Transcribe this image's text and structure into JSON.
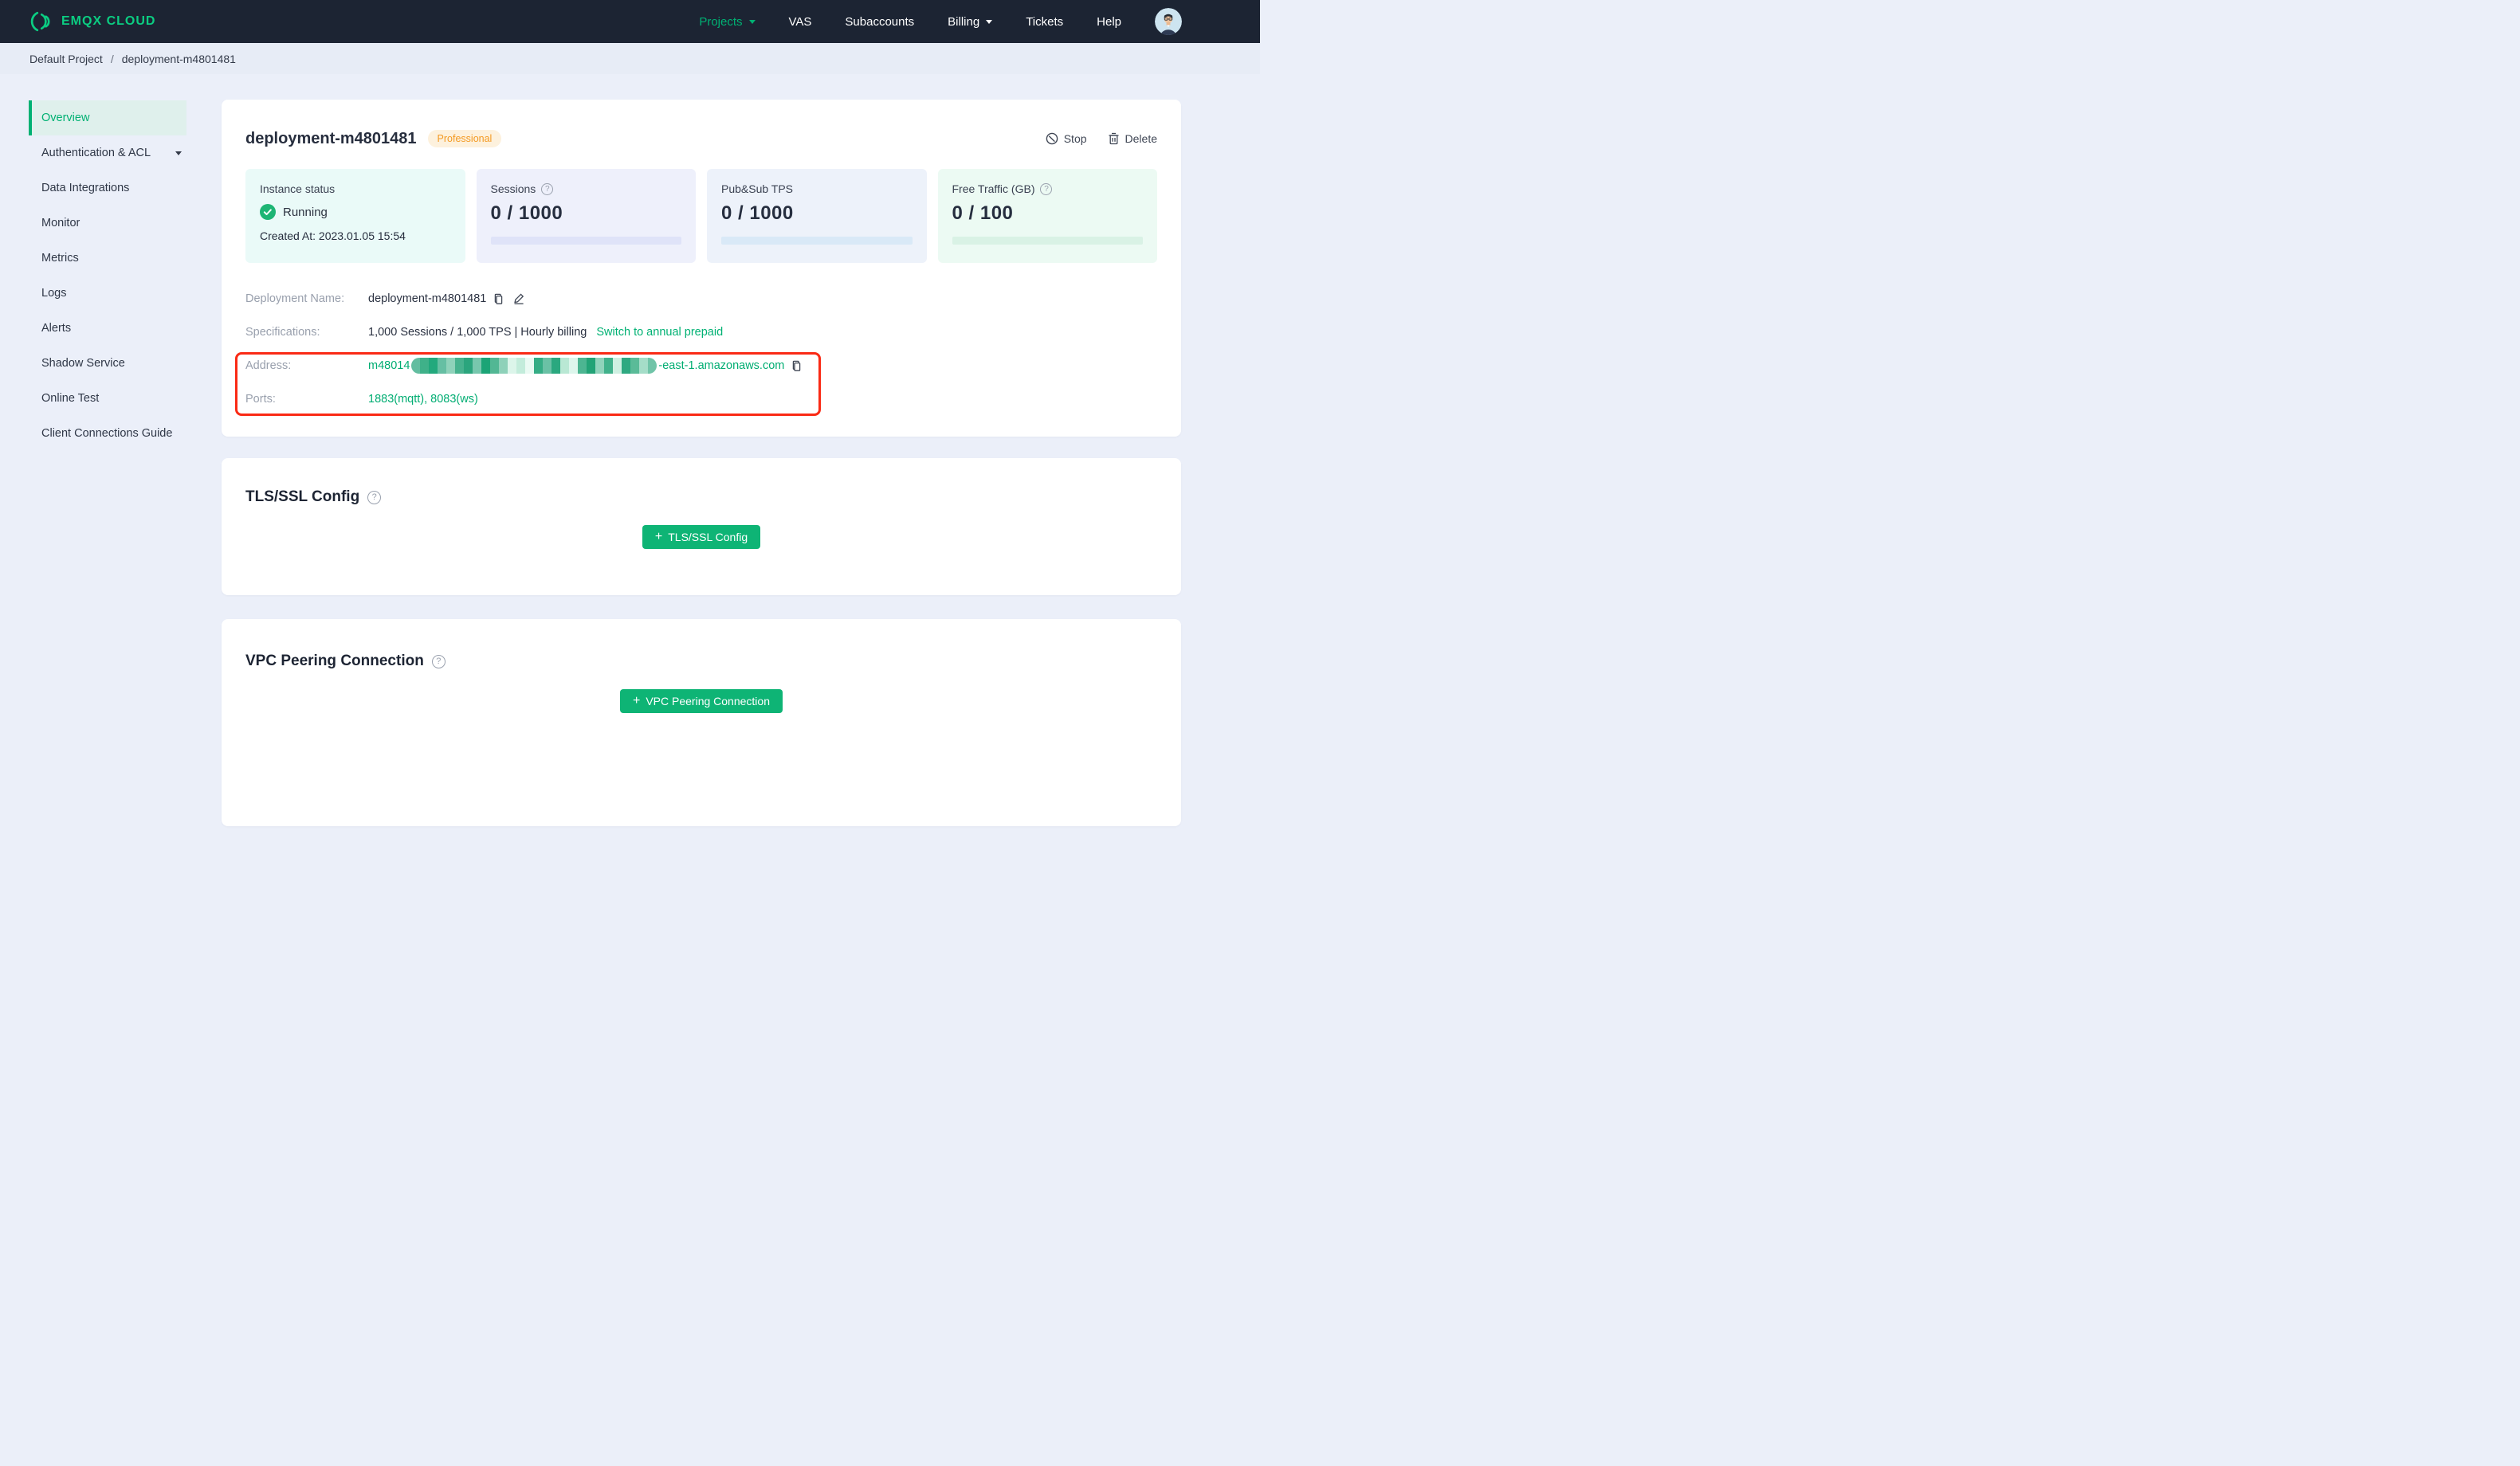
{
  "navbar": {
    "logo_text": "EMQX CLOUD",
    "items": [
      {
        "label": "Projects"
      },
      {
        "label": "VAS"
      },
      {
        "label": "Subaccounts"
      },
      {
        "label": "Billing"
      },
      {
        "label": "Tickets"
      },
      {
        "label": "Help"
      }
    ]
  },
  "breadcrumb": {
    "project": "Default Project",
    "separator": "/",
    "deployment": "deployment-m4801481"
  },
  "sidebar": {
    "items": [
      {
        "label": "Overview"
      },
      {
        "label": "Authentication & ACL"
      },
      {
        "label": "Data Integrations"
      },
      {
        "label": "Monitor"
      },
      {
        "label": "Metrics"
      },
      {
        "label": "Logs"
      },
      {
        "label": "Alerts"
      },
      {
        "label": "Shadow Service"
      },
      {
        "label": "Online Test"
      },
      {
        "label": "Client Connections Guide"
      }
    ]
  },
  "overview": {
    "title": "deployment-m4801481",
    "badge": "Professional",
    "stop_label": "Stop",
    "delete_label": "Delete",
    "stats": [
      {
        "label": "Instance status",
        "status": "Running",
        "created": "Created At: 2023.01.05 15:54"
      },
      {
        "label": "Sessions",
        "value": "0 / 1000"
      },
      {
        "label": "Pub&Sub TPS",
        "value": "0 / 1000"
      },
      {
        "label": "Free Traffic (GB)",
        "value": "0 / 100"
      }
    ],
    "details": {
      "name_label": "Deployment Name:",
      "name_value": "deployment-m4801481",
      "spec_label": "Specifications:",
      "spec_value": "1,000 Sessions / 1,000 TPS | Hourly billing",
      "spec_link": "Switch to annual prepaid",
      "address_label": "Address:",
      "address_prefix": "m48014",
      "address_suffix": "-east-1.amazonaws.com",
      "ports_label": "Ports:",
      "ports_value": "1883(mqtt), 8083(ws)"
    }
  },
  "tls": {
    "heading": "TLS/SSL Config",
    "button": "TLS/SSL Config"
  },
  "vpc": {
    "heading": "VPC Peering Connection",
    "button": "VPC Peering Connection"
  },
  "colors": {
    "brand_green": "#00b173",
    "button_green": "#0eb475",
    "navbar_bg": "#1c2433",
    "badge_text": "#f49a23",
    "badge_bg": "#fdf1dd",
    "annotation_red": "#fa2a15",
    "running_green": "#1db574"
  },
  "redaction_palette": [
    "#63bda0",
    "#3fb189",
    "#22a97d",
    "#66bfa3",
    "#8fd2ba",
    "#47b28e",
    "#2ba57d",
    "#77c7ad",
    "#1ba476",
    "#52b794",
    "#8ed1b9",
    "#dcf5ea",
    "#c3ecdb",
    "#eafaf3",
    "#35ad85",
    "#6ac1a5",
    "#2aa87f",
    "#b9e8d4",
    "#ddf6ec",
    "#4cb591",
    "#22a376",
    "#90d3bb",
    "#41b18b",
    "#cff0e2",
    "#2fa981",
    "#5abb98",
    "#a5ddc8",
    "#70c4a8"
  ]
}
